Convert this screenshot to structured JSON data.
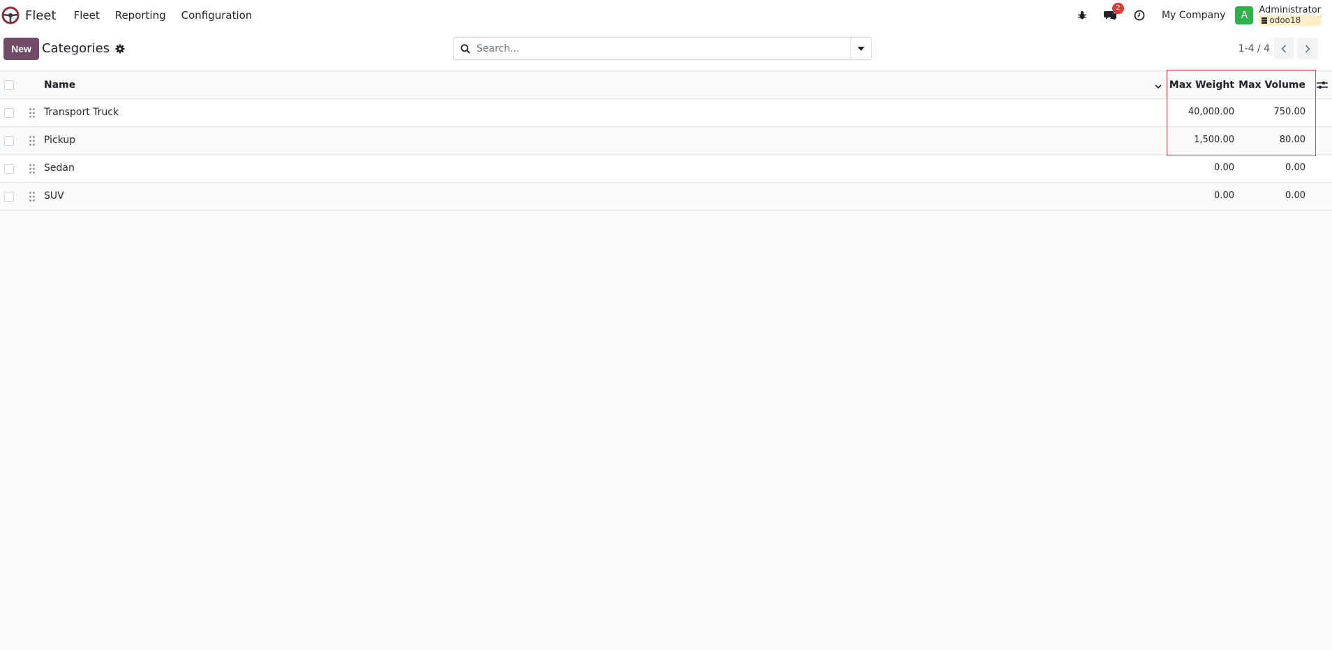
{
  "navbar": {
    "app_name": "Fleet",
    "menu": [
      "Fleet",
      "Reporting",
      "Configuration"
    ],
    "messages_badge": "2",
    "company": "My Company",
    "avatar_letter": "A",
    "user_name": "Administrator",
    "database": "odoo18",
    "avatar_color": "#2eb24a"
  },
  "control": {
    "new_label": "New",
    "title": "Categories",
    "search_placeholder": "Search...",
    "pager": "1-4 / 4"
  },
  "table": {
    "headers": {
      "name": "Name",
      "max_weight": "Max Weight",
      "max_volume": "Max Volume"
    },
    "rows": [
      {
        "name": "Transport Truck",
        "max_weight": "40,000.00",
        "max_volume": "750.00"
      },
      {
        "name": "Pickup",
        "max_weight": "1,500.00",
        "max_volume": "80.00"
      },
      {
        "name": "Sedan",
        "max_weight": "0.00",
        "max_volume": "0.00"
      },
      {
        "name": "SUV",
        "max_weight": "0.00",
        "max_volume": "0.00"
      }
    ]
  },
  "colors": {
    "primary": "#714b67",
    "highlight": "#e8424c"
  }
}
